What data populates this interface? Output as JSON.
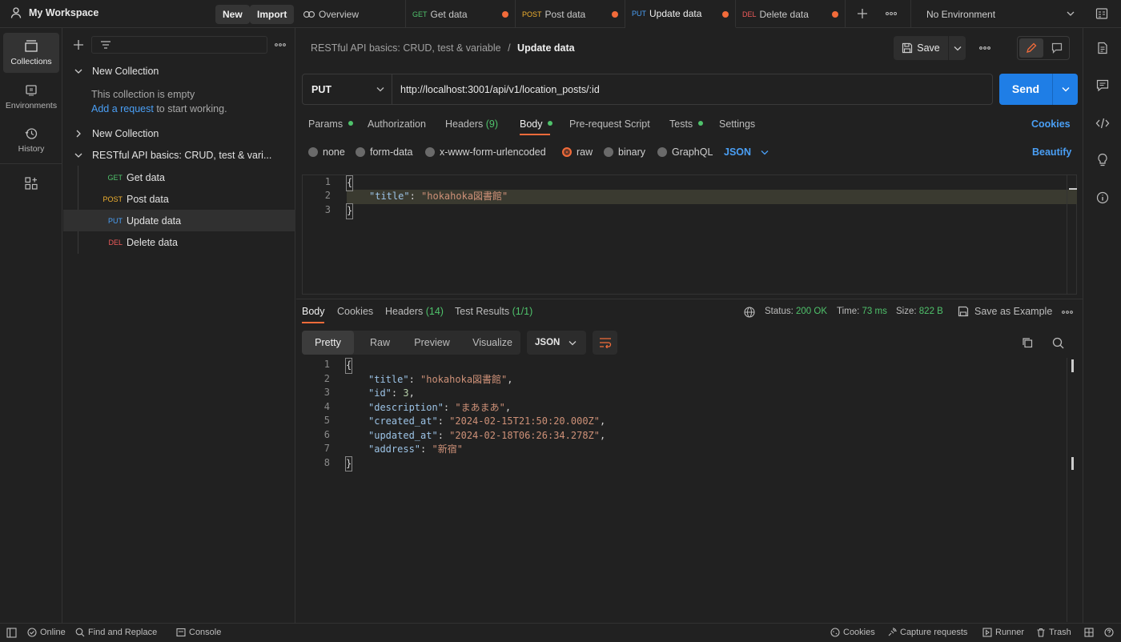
{
  "workspace": {
    "name": "My Workspace",
    "new_label": "New",
    "import_label": "Import"
  },
  "tabs": [
    {
      "method": "",
      "label": "Overview"
    },
    {
      "method": "GET",
      "label": "Get data"
    },
    {
      "method": "POST",
      "label": "Post data"
    },
    {
      "method": "PUT",
      "label": "Update data"
    },
    {
      "method": "DEL",
      "label": "Delete data"
    }
  ],
  "environment": {
    "selected": "No Environment"
  },
  "rail": {
    "collections": "Collections",
    "environments": "Environments",
    "history": "History"
  },
  "sidebar": {
    "collection1": {
      "name": "New Collection",
      "empty_text": "This collection is empty",
      "add_link": "Add a request",
      "add_suffix": " to start working."
    },
    "collection2": {
      "name": "New Collection"
    },
    "collection3": {
      "name": "RESTful API basics: CRUD, test & vari...",
      "requests": [
        {
          "method": "GET",
          "label": "Get data"
        },
        {
          "method": "POST",
          "label": "Post data"
        },
        {
          "method": "PUT",
          "label": "Update data"
        },
        {
          "method": "DEL",
          "label": "Delete data"
        }
      ]
    }
  },
  "breadcrumb": {
    "parent": "RESTful API basics: CRUD, test & variable",
    "separator": "/",
    "current": "Update data"
  },
  "toolbar": {
    "save_label": "Save"
  },
  "request": {
    "method": "PUT",
    "url": "http://localhost:3001/api/v1/location_posts/:id",
    "send_label": "Send",
    "tabs": {
      "params": "Params",
      "authorization": "Authorization",
      "headers": "Headers",
      "headers_count": "(9)",
      "body": "Body",
      "prerequest": "Pre-request Script",
      "tests": "Tests",
      "settings": "Settings"
    },
    "cookies_link": "Cookies",
    "body_types": {
      "none": "none",
      "formdata": "form-data",
      "urlencoded": "x-www-form-urlencoded",
      "raw": "raw",
      "binary": "binary",
      "graphql": "GraphQL"
    },
    "body_format": "JSON",
    "beautify_label": "Beautify",
    "body_lines": [
      {
        "n": "1",
        "text": "{"
      },
      {
        "n": "2",
        "key": "\"title\"",
        "val": "\"hokahoka図書館\""
      },
      {
        "n": "3",
        "text": "}"
      }
    ]
  },
  "response": {
    "tabs": {
      "body": "Body",
      "cookies": "Cookies",
      "headers": "Headers",
      "headers_count": "(14)",
      "tests": "Test Results",
      "tests_count": "(1/1)"
    },
    "status_label": "Status:",
    "status_value": "200 OK",
    "time_label": "Time:",
    "time_value": "73 ms",
    "size_label": "Size:",
    "size_value": "822 B",
    "save_example": "Save as Example",
    "views": {
      "pretty": "Pretty",
      "raw": "Raw",
      "preview": "Preview",
      "visualize": "Visualize"
    },
    "format": "JSON",
    "lines": [
      {
        "n": "1",
        "text": "{"
      },
      {
        "n": "2",
        "key": "\"title\"",
        "val": "\"hokahoka図書館\"",
        "comma": ","
      },
      {
        "n": "3",
        "key": "\"id\"",
        "num": "3",
        "comma": ","
      },
      {
        "n": "4",
        "key": "\"description\"",
        "val": "\"まあまあ\"",
        "comma": ","
      },
      {
        "n": "5",
        "key": "\"created_at\"",
        "val": "\"2024-02-15T21:50:20.000Z\"",
        "comma": ","
      },
      {
        "n": "6",
        "key": "\"updated_at\"",
        "val": "\"2024-02-18T06:26:34.278Z\"",
        "comma": ","
      },
      {
        "n": "7",
        "key": "\"address\"",
        "val": "\"新宿\""
      },
      {
        "n": "8",
        "text": "}"
      }
    ]
  },
  "statusbar": {
    "online": "Online",
    "find_replace": "Find and Replace",
    "console": "Console",
    "cookies": "Cookies",
    "capture": "Capture requests",
    "runner": "Runner",
    "trash": "Trash"
  },
  "colors": {
    "accent": "#f26b3a",
    "send": "#1f7ee6",
    "get": "#4fc26b",
    "post": "#f1b12f",
    "put": "#4a9ff5",
    "del": "#ef5b5b"
  }
}
